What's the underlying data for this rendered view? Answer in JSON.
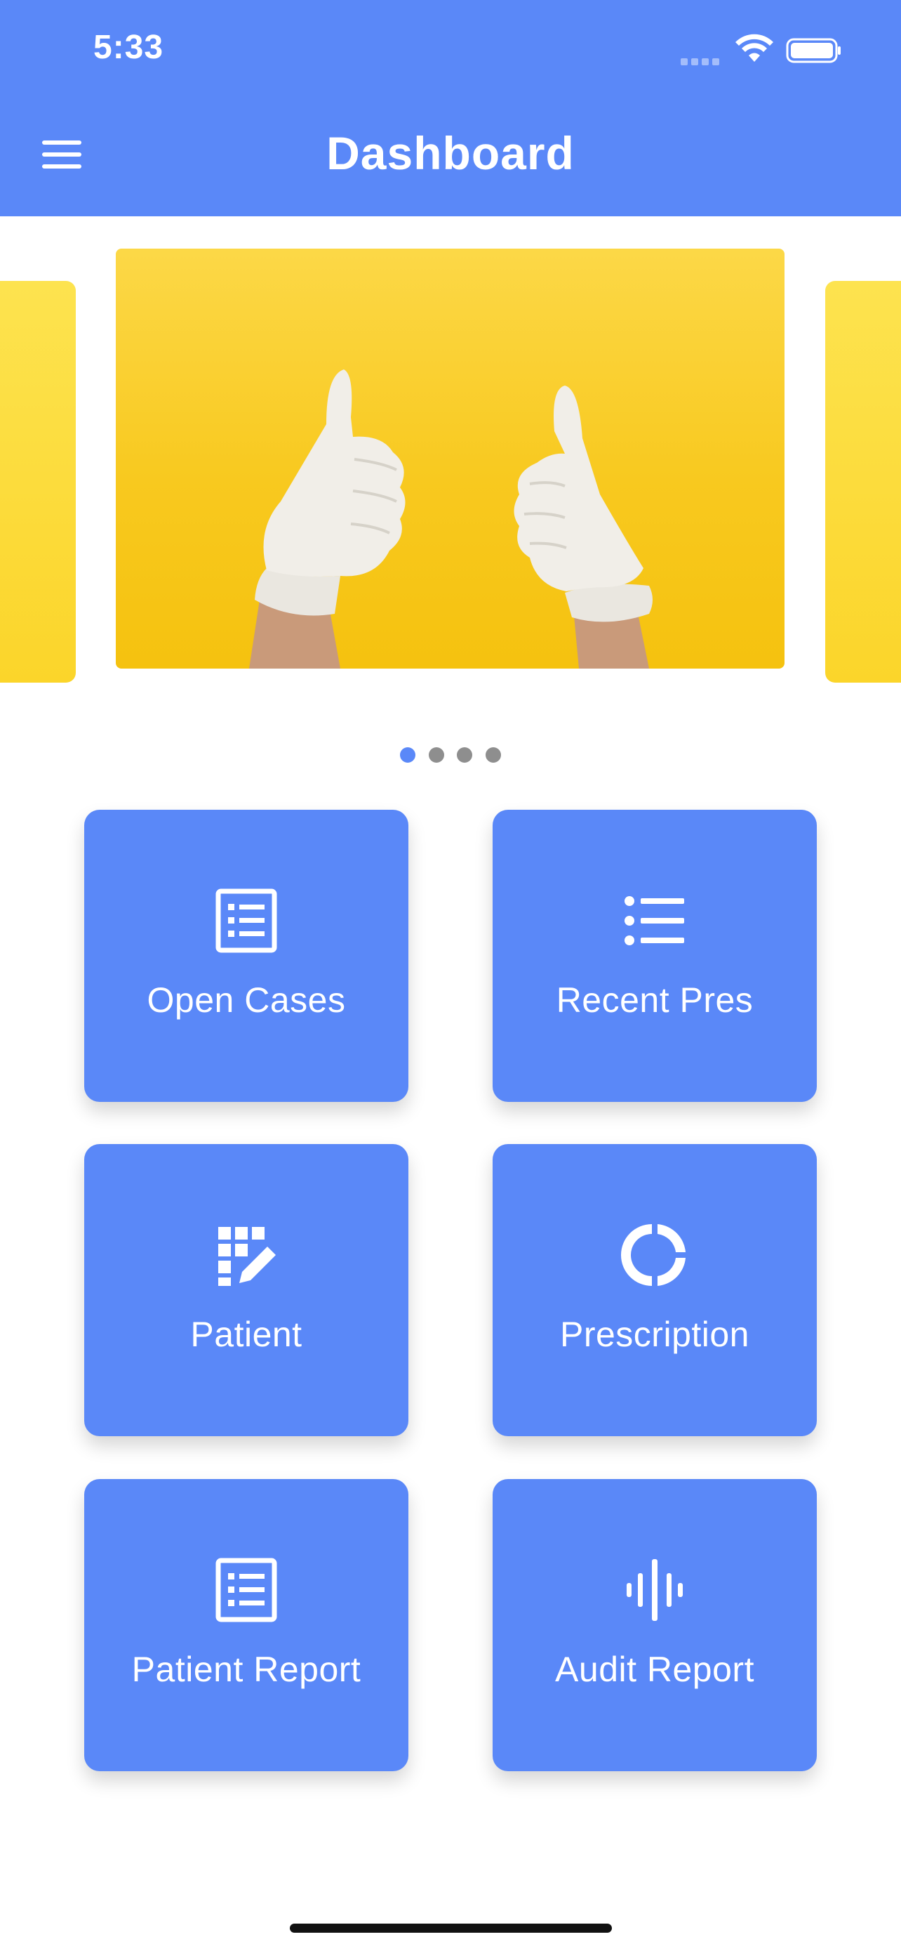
{
  "status_bar": {
    "time": "5:33"
  },
  "header": {
    "title": "Dashboard",
    "menu_icon": "hamburger-menu-icon"
  },
  "carousel": {
    "slide_count": 4,
    "active_index": 0,
    "main_slide_image": "gloved-thumbs-up-on-yellow"
  },
  "tiles": [
    {
      "label": "Open Cases",
      "icon": "list-document-icon"
    },
    {
      "label": "Recent Pres",
      "icon": "bullet-list-icon"
    },
    {
      "label": "Patient",
      "icon": "grid-edit-icon"
    },
    {
      "label": "Prescription",
      "icon": "donut-progress-icon"
    },
    {
      "label": "Patient Report",
      "icon": "list-document-icon"
    },
    {
      "label": "Audit Report",
      "icon": "audio-waveform-icon"
    }
  ],
  "colors": {
    "primary": "#5a88f8",
    "slide_yellow": "#f8c91f",
    "dot_inactive": "#8e8e8e"
  }
}
